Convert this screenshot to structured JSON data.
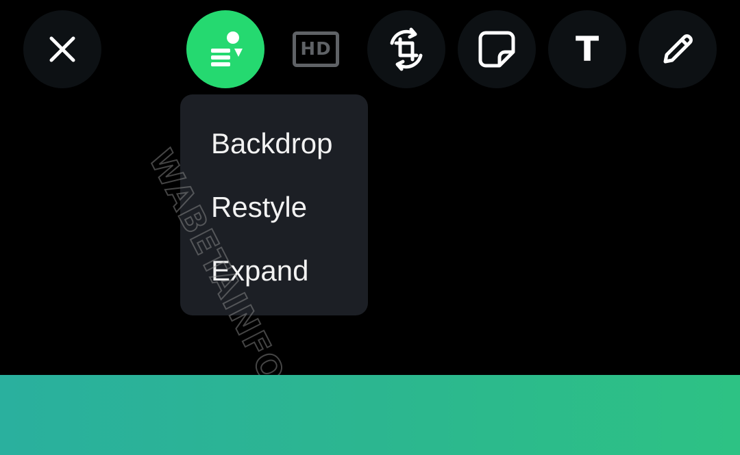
{
  "toolbar": {
    "close_icon": "close-icon",
    "ai_edit_icon": "ai-image-edit-icon",
    "ai_edit_accent": "#25d970",
    "hd_label": "HD",
    "crop_icon": "crop-rotate-icon",
    "sticker_icon": "sticker-icon",
    "text_label": "T",
    "pencil_icon": "pencil-icon"
  },
  "menu": {
    "items": [
      {
        "label": "Backdrop"
      },
      {
        "label": "Restyle"
      },
      {
        "label": "Expand"
      }
    ]
  },
  "watermark": {
    "text": "WABETAINFO"
  },
  "colors": {
    "background": "#000000",
    "button_bg": "#0d1114",
    "menu_bg": "#1c1f25",
    "accent": "#25d970",
    "strip_start": "#2ab09e",
    "strip_end": "#2dc284"
  }
}
